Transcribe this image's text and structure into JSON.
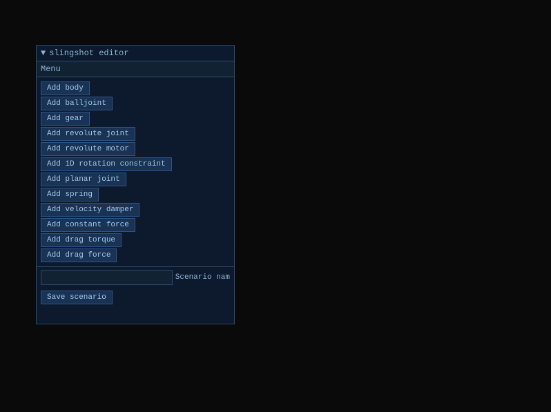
{
  "panel": {
    "title": "slingshot editor",
    "menu_label": "Menu",
    "buttons": [
      {
        "id": "add-body",
        "label": "Add body"
      },
      {
        "id": "add-balljoint",
        "label": "Add balljoint"
      },
      {
        "id": "add-gear",
        "label": "Add gear"
      },
      {
        "id": "add-revolute-joint",
        "label": "Add revolute joint"
      },
      {
        "id": "add-revolute-motor",
        "label": "Add revolute motor"
      },
      {
        "id": "add-1d-rotation",
        "label": "Add 1D rotation constraint"
      },
      {
        "id": "add-planar-joint",
        "label": "Add planar joint"
      },
      {
        "id": "add-spring",
        "label": "Add spring"
      },
      {
        "id": "add-velocity-damper",
        "label": "Add velocity damper"
      },
      {
        "id": "add-constant-force",
        "label": "Add constant force"
      },
      {
        "id": "add-drag-torque",
        "label": "Add drag torque"
      },
      {
        "id": "add-drag-force",
        "label": "Add drag force"
      }
    ],
    "scenario_label": "Scenario nam",
    "scenario_placeholder": "",
    "save_label": "Save scenario"
  }
}
